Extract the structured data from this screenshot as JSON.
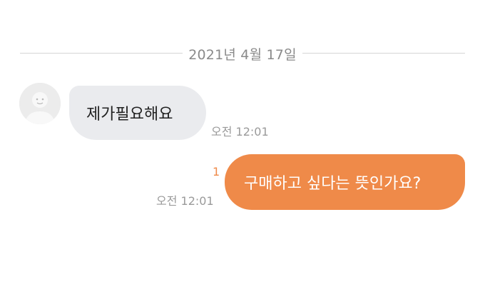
{
  "chat": {
    "date_divider": "2021년 4월 17일",
    "messages": [
      {
        "direction": "incoming",
        "text": "제가필요해요",
        "time": "오전 12:01"
      },
      {
        "direction": "outgoing",
        "text": "구매하고 싶다는 뜻인가요?",
        "time": "오전 12:01",
        "unread_count": "1"
      }
    ]
  },
  "colors": {
    "outgoing_bubble": "#ef8a49",
    "incoming_bubble": "#eaebee",
    "unread_count": "#ef8a49"
  },
  "icons": {
    "avatar": "default-profile-avatar-icon"
  }
}
